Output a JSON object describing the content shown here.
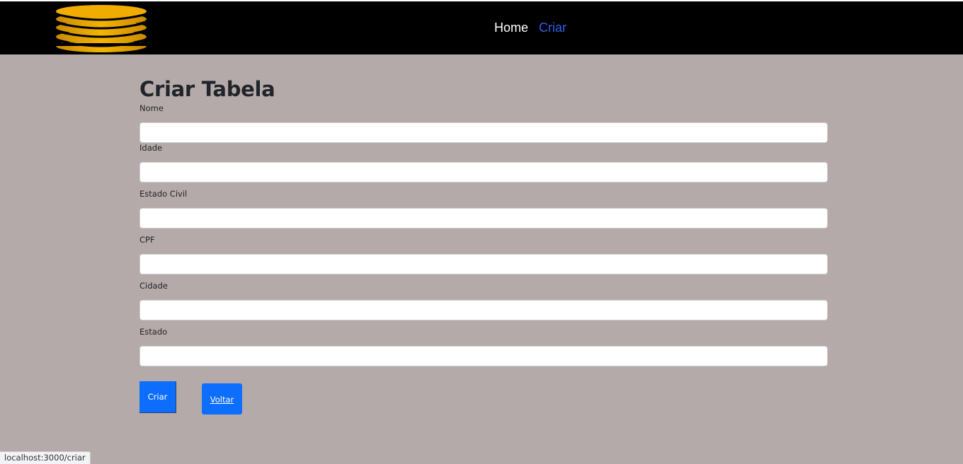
{
  "nav": {
    "logo_icon": "coin-stack-icon",
    "home_label": "Home",
    "criar_label": "Criar"
  },
  "colors": {
    "navbar_bg": "#000000",
    "page_bg": "#b5aaaa",
    "active_link": "#2e5fe8",
    "primary_button": "#0d6efd",
    "logo_gold": "#f0ad00"
  },
  "form": {
    "title": "Criar Tabela",
    "fields": [
      {
        "label": "Nome",
        "value": "",
        "placeholder": ""
      },
      {
        "label": "Idade",
        "value": "",
        "placeholder": ""
      },
      {
        "label": "Estado Civil",
        "value": "",
        "placeholder": ""
      },
      {
        "label": "CPF",
        "value": "",
        "placeholder": ""
      },
      {
        "label": "Cidade",
        "value": "",
        "placeholder": ""
      },
      {
        "label": "Estado",
        "value": "",
        "placeholder": ""
      }
    ],
    "submit_label": "Criar",
    "back_label": "Voltar"
  },
  "status": {
    "url": "localhost:3000/criar"
  }
}
